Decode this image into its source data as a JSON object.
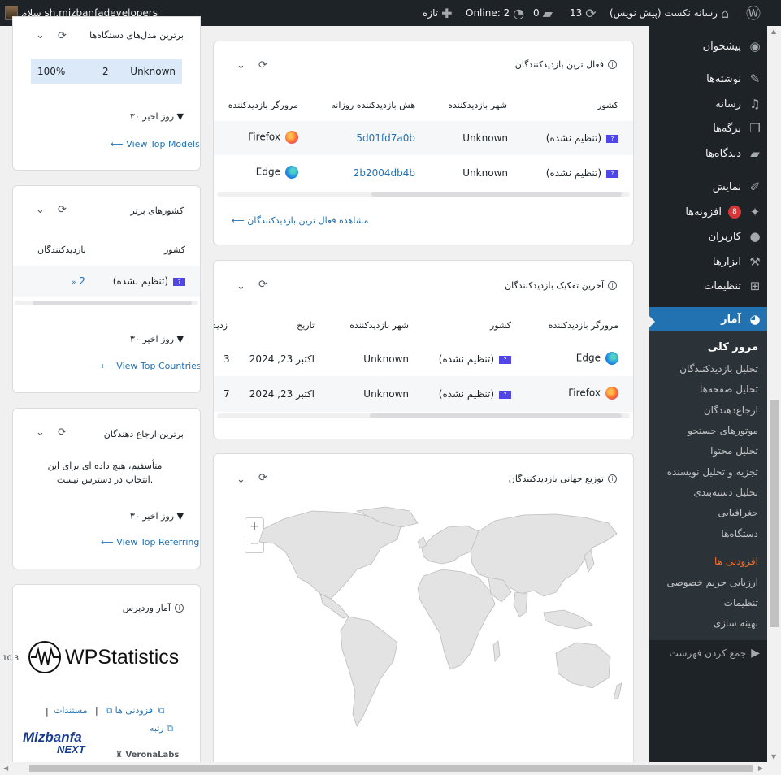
{
  "admin_bar": {
    "greeting": "سلام sh.mizbanfadevelopers",
    "site_name": "رسانه نکست (پیش نویس)",
    "updates_count": "13",
    "comments_count": "0",
    "online_label": "Online: 2",
    "new_label": "تازه"
  },
  "sidebar": {
    "items": [
      {
        "label": "پیشخوان",
        "icon": "dashboard-icon"
      },
      {
        "label": "نوشته‌ها",
        "icon": "pin-icon"
      },
      {
        "label": "رسانه",
        "icon": "media-icon"
      },
      {
        "label": "برگه‌ها",
        "icon": "page-icon"
      },
      {
        "label": "دیدگاه‌ها",
        "icon": "comment-icon"
      },
      {
        "label": "نمایش",
        "icon": "brush-icon"
      },
      {
        "label": "افزونه‌ها",
        "icon": "plugin-icon",
        "badge": "8"
      },
      {
        "label": "کاربران",
        "icon": "user-icon"
      },
      {
        "label": "ابزارها",
        "icon": "wrench-icon"
      },
      {
        "label": "تنظیمات",
        "icon": "settings-icon"
      },
      {
        "label": "آمار",
        "icon": "chart-pie-icon"
      }
    ],
    "submenu": [
      "مرور کلی",
      "تحلیل بازدیدکنندگان",
      "تحلیل صفحه‌ها",
      "ارجاع‌دهندگان",
      "موتورهای جستجو",
      "تحلیل محتوا",
      "تجزیه و تحلیل نویسنده",
      "تحلیل دسته‌بندی",
      "جغرافیایی",
      "دستگاه‌ها",
      "افزودنی ها",
      "ارزیابی حریم خصوصی",
      "تنظیمات",
      "بهینه سازی"
    ],
    "collapse_label": "جمع کردن فهرست"
  },
  "top_models": {
    "title": "برترین مدل‌های دستگاه‌ها",
    "row": {
      "model": "Unknown",
      "count": "2",
      "percent": "100%"
    },
    "period": "۳۰ روز اخیر",
    "link": "View Top Models"
  },
  "top_countries": {
    "title": "کشورهای برتر",
    "col_country": "کشور",
    "col_visitors": "بازدیدکنندگان",
    "row": {
      "country": "(تنظیم نشده)",
      "count": "2",
      "flag": "?"
    },
    "period": "۳۰ روز اخیر",
    "link": "View Top Countries"
  },
  "top_referring": {
    "title": "برترین ارجاع دهندگان",
    "empty_message": "متأسفیم، هیچ داده ای برای این انتخاب در دسترس نیست.",
    "period": "۳۰ روز اخیر",
    "link": "View Top Referring"
  },
  "wp_stats": {
    "title": "آمار وردپرس",
    "logo_text": "WPStatistics",
    "version": "10.3",
    "docs_link": "مستندات",
    "addons_link": "افزودنی ها",
    "rate_link": "رتبه",
    "separator": "|",
    "mizbanfa_text": "Mizbanfa",
    "mizbanfa_next": "NEXT",
    "verona": "VeronaLabs"
  },
  "active_visitors": {
    "title": "فعال ترین بازدیدکنندگان",
    "columns": [
      "کشور",
      "شهر بازدیدکننده",
      "هش بازدیدکننده روزانه",
      "مرورگر بازدیدکننده"
    ],
    "rows": [
      {
        "country": "(تنظیم نشده)",
        "city": "Unknown",
        "hash": "5d01fd7a0b",
        "browser": "Firefox"
      },
      {
        "country": "(تنظیم نشده)",
        "city": "Unknown",
        "hash": "2b2004db4b",
        "browser": "Edge"
      }
    ],
    "link": "مشاهده فعال ترین بازدیدکنندگان"
  },
  "latest_visitors": {
    "title": "آخرین تفکیک بازدیدکنندگان",
    "columns": [
      "مرورگر بازدیدکننده",
      "کشور",
      "شهر بازدیدکننده",
      "تاریخ",
      "بازدید"
    ],
    "rows": [
      {
        "browser": "Edge",
        "country": "(تنظیم نشده)",
        "city": "Unknown",
        "date": "اکتبر 23, 2024",
        "views": "3"
      },
      {
        "browser": "Firefox",
        "country": "(تنظیم نشده)",
        "city": "Unknown",
        "date": "اکتبر 23, 2024",
        "views": "7"
      }
    ]
  },
  "world_map": {
    "title": "توزیع جهانی بازدیدکنندگان",
    "zoom_in": "+",
    "zoom_out": "−"
  },
  "flag_glyph": "?"
}
